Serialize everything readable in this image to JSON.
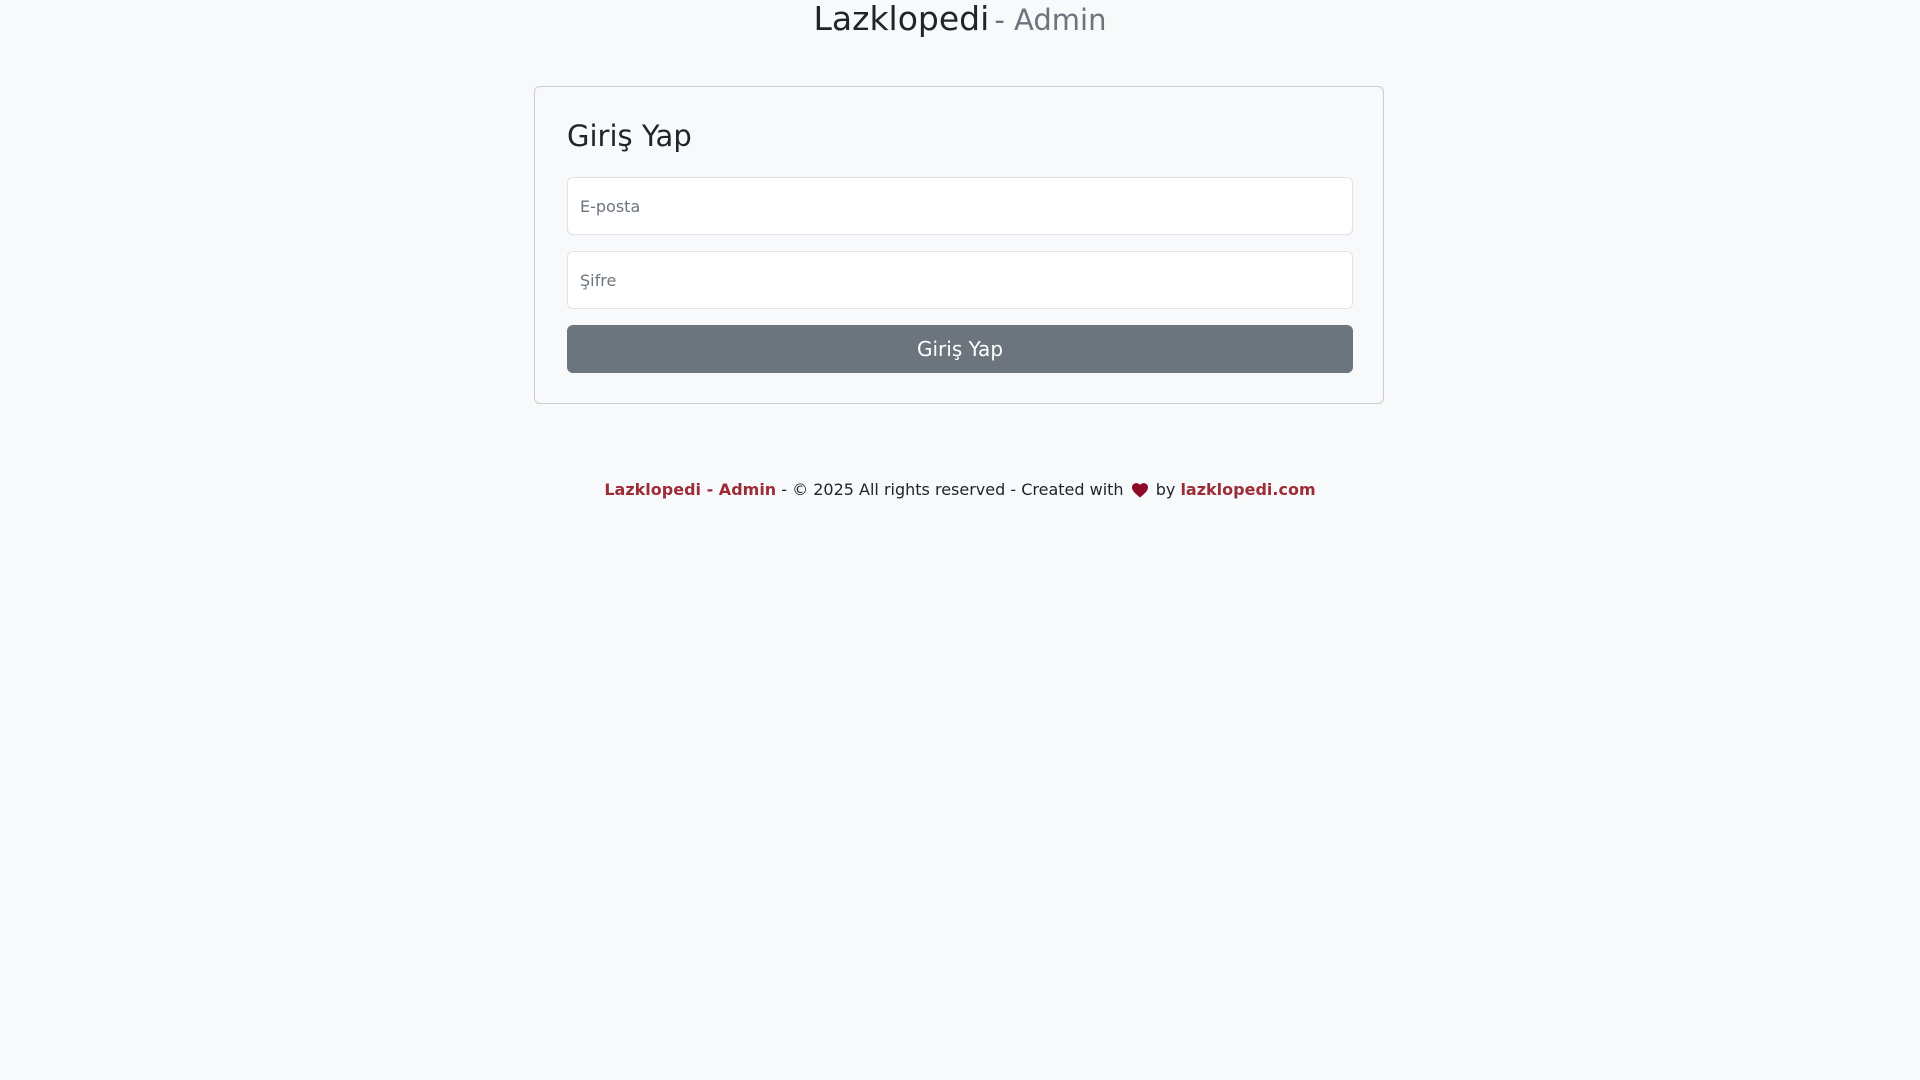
{
  "header": {
    "brand": "Lazklopedi",
    "suffix": "- Admin"
  },
  "login_form": {
    "title": "Giriş Yap",
    "email_placeholder": "E-posta",
    "password_placeholder": "Şifre",
    "submit_label": "Giriş Yap"
  },
  "footer": {
    "site_link": "Lazklopedi - Admin",
    "copyright_text": " - © 2025 All rights reserved - Created with ",
    "heart_icon": "heart-icon",
    "by_text": " by ",
    "author_link": "lazklopedi.com"
  },
  "colors": {
    "background": "#f8f9fa",
    "button": "#6c757d",
    "link": "#9c2c36",
    "heart": "#8b0a24"
  }
}
